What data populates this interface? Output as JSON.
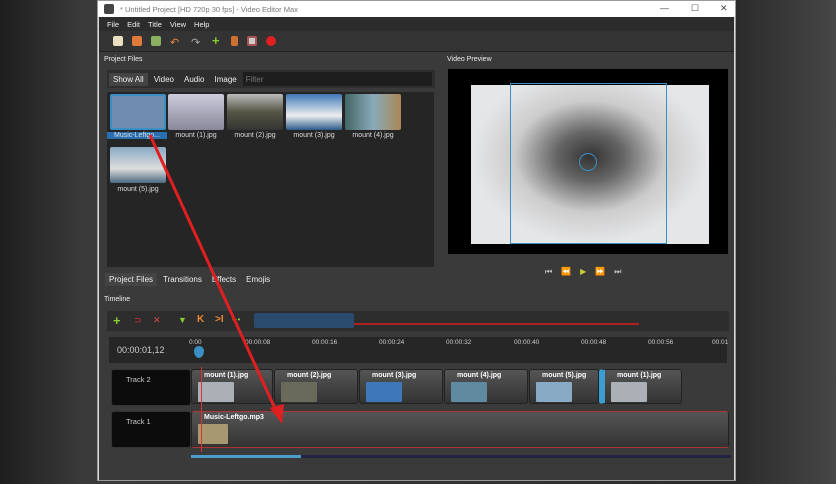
{
  "window": {
    "title": "* Untitled Project [HD 720p 30 fps] - Video Editor Max",
    "minimize": "—",
    "maximize": "☐",
    "close": "✕"
  },
  "menu": [
    "File",
    "Edit",
    "Title",
    "View",
    "Help"
  ],
  "project_files": {
    "title": "Project Files",
    "filters": [
      "Show All",
      "Video",
      "Audio",
      "Image"
    ],
    "filter_placeholder": "Filter",
    "items": [
      {
        "name": "Music-Leftgo...",
        "color": "#6f8db0"
      },
      {
        "name": "mount (1).jpg",
        "color": "#aab0b6"
      },
      {
        "name": "mount (2).jpg",
        "color": "#6a6a5a"
      },
      {
        "name": "mount (3).jpg",
        "color": "#3f78b8"
      },
      {
        "name": "mount (4).jpg",
        "color": "#5f8aa0"
      },
      {
        "name": "mount (5).jpg",
        "color": "#89aac4"
      }
    ]
  },
  "bottom_tabs": [
    "Project Files",
    "Transitions",
    "Effects",
    "Emojis"
  ],
  "preview": {
    "title": "Video Preview"
  },
  "timeline": {
    "title": "Timeline",
    "timecode": "00:00:01,12",
    "ruler": [
      "0:00",
      "00:00:08",
      "00:00:16",
      "00:00:24",
      "00:00:32",
      "00:00:40",
      "00:00:48",
      "00:00:56",
      "00:01"
    ],
    "tracks": [
      {
        "name": "Track 2",
        "clips": [
          "mount (1).jpg",
          "mount (2).jpg",
          "mount (3).jpg",
          "mount (4).jpg",
          "mount (5).jpg",
          "mount (1).jpg"
        ]
      },
      {
        "name": "Track 1",
        "clips": [
          "Music-Leftgo.mp3"
        ]
      }
    ]
  },
  "colors": {
    "accent": "#3a8fc4",
    "playhead": "#e03030"
  }
}
